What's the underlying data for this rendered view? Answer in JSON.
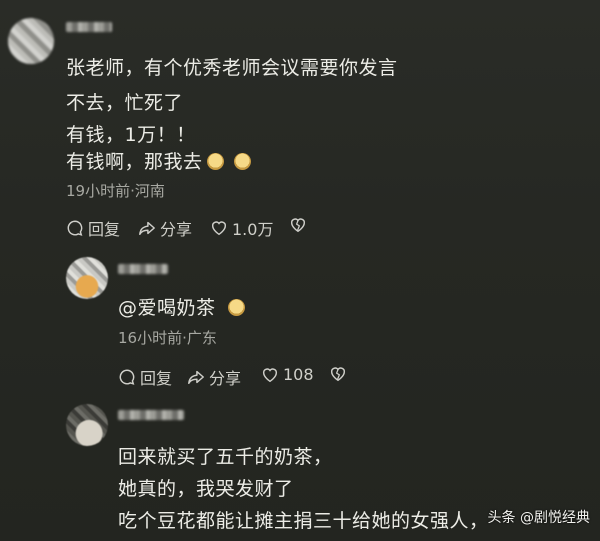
{
  "comment1": {
    "lines": [
      "张老师，有个优秀老师会议需要你发言",
      "不去，忙死了",
      "有钱，1万！！",
      "有钱啊，那我去"
    ],
    "meta": "19小时前·河南",
    "actions": {
      "reply": "回复",
      "share": "分享",
      "likes": "1.0万"
    }
  },
  "reply1": {
    "text": "@爱喝奶茶",
    "meta": "16小时前·广东",
    "actions": {
      "reply": "回复",
      "share": "分享",
      "likes": "108"
    }
  },
  "reply2": {
    "lines": [
      "回来就买了五千的奶茶，",
      "她真的，我哭发财了",
      "吃个豆花都能让摊主捐三十给她的女强人，"
    ]
  },
  "watermark": "头条 @剧悦经典",
  "icons": [
    "reply-icon",
    "share-icon",
    "heart-icon",
    "dislike-icon",
    "emoji-icon"
  ]
}
